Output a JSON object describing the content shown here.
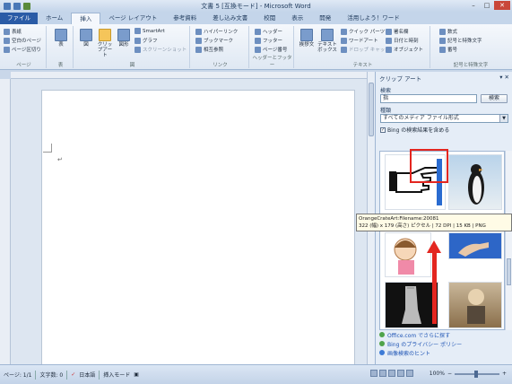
{
  "window": {
    "title": "文書 5 [互換モード] - Microsoft Word"
  },
  "tabs": [
    "ファイル",
    "ホーム",
    "挿入",
    "ページ レイアウト",
    "参考資料",
    "差し込み文書",
    "校閲",
    "表示",
    "開発",
    "活用しよう！ワード"
  ],
  "ribbon": {
    "pages_group": {
      "items": [
        "表紙",
        "空白のページ",
        "ページ区切り"
      ],
      "label": "ページ"
    },
    "table_group": {
      "button": "表",
      "label": "表"
    },
    "illust_group": {
      "buttons": [
        "図",
        "クリップアート",
        "図形"
      ],
      "side": [
        "SmartArt",
        "グラフ",
        "スクリーンショット"
      ],
      "label": "図"
    },
    "link_group": {
      "items": [
        "ハイパーリンク",
        "ブックマーク",
        "相互参照"
      ],
      "label": "リンク"
    },
    "hf_group": {
      "items": [
        "ヘッダー",
        "フッター",
        "ページ番号"
      ],
      "label": "ヘッダーとフッター"
    },
    "text_group": {
      "buttons": [
        "挨拶文",
        "テキストボックス"
      ],
      "items": [
        "クイック パーツ",
        "ワードアート",
        "ドロップ キャップ",
        "署名欄",
        "日付と時刻",
        "オブジェクト"
      ],
      "label": "テキスト"
    },
    "symbol_group": {
      "items": [
        "数式",
        "記号と特殊文字",
        "番号"
      ],
      "label": "記号と特殊文字"
    }
  },
  "clipart_pane": {
    "title": "クリップ アート",
    "search_label": "検索",
    "search_value": "指",
    "search_button": "検索",
    "type_label": "種類",
    "type_value": "すべてのメディア ファイル形式",
    "bing_check": "Bing の検索結果を含める",
    "links": [
      "Office.com でさらに探す",
      "Bing のプライバシー ポリシー",
      "画像検索のヒント"
    ]
  },
  "tooltip": {
    "line1": "OrangeCrateArt:Filename:20081",
    "line2": "322 (幅) x 179 (高さ) ピクセル | 72 DPI | 15 KB | PNG"
  },
  "statusbar": {
    "page": "ページ: 1/1",
    "words": "文字数: 0",
    "lang": "日本語",
    "mode": "挿入モード",
    "zoom": "100%"
  },
  "colors": {
    "highlight": "#e32620",
    "accent": "#2a5ba6"
  }
}
